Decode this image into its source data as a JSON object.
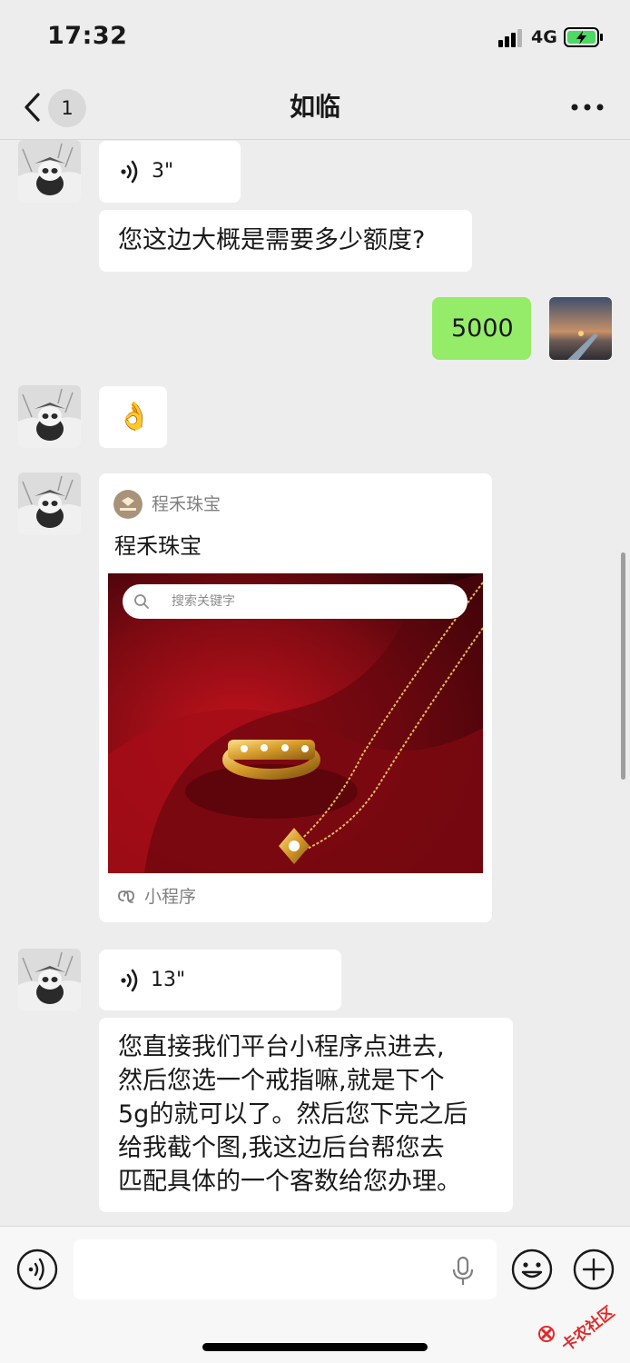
{
  "status_bar": {
    "time": "17:32",
    "network": "4G"
  },
  "nav": {
    "back_count": "1",
    "title": "如临"
  },
  "messages": {
    "voice1_duration": "3\"",
    "text1": "您这边大概是需要多少额度?",
    "me_text": "5000",
    "emoji": "👌",
    "card": {
      "source": "程禾珠宝",
      "title": "程禾珠宝",
      "search_placeholder": "搜索关键字",
      "footer": "小程序"
    },
    "voice2_duration": "13\"",
    "text2_lines": [
      "您直接我们平台小程序点进去,",
      "然后您选一个戒指嘛,就是下个",
      "5g的就可以了。然后您下完之后",
      "给我截个图,我这边后台帮您去",
      "匹配具体的一个客数给您办理。"
    ]
  },
  "watermark": "卡农社区",
  "colors": {
    "background": "#ededed",
    "bubble_me": "#95ec69",
    "bubble_other": "#ffffff",
    "battery_fill": "#4cd964"
  }
}
